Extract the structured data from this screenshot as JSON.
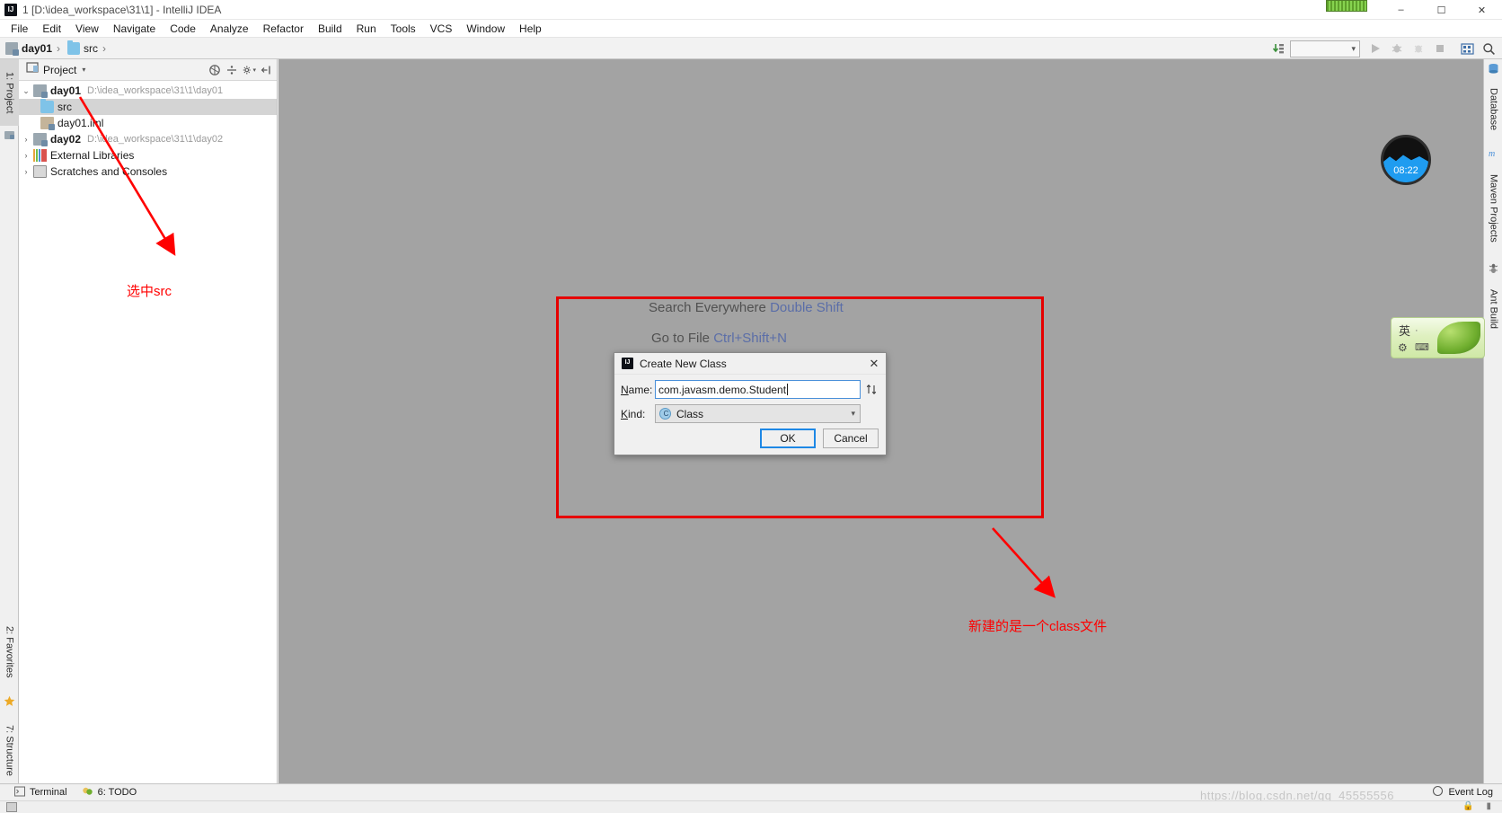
{
  "window": {
    "title": "1 [D:\\idea_workspace\\31\\1] - IntelliJ IDEA",
    "logo_icon": "intellij-idea-logo-icon",
    "minimize_icon": "minimize-icon",
    "maximize_icon": "maximize-icon",
    "close_icon": "close-icon"
  },
  "menubar": {
    "items": [
      {
        "label": "File"
      },
      {
        "label": "Edit"
      },
      {
        "label": "View"
      },
      {
        "label": "Navigate"
      },
      {
        "label": "Code"
      },
      {
        "label": "Analyze"
      },
      {
        "label": "Refactor"
      },
      {
        "label": "Build"
      },
      {
        "label": "Run"
      },
      {
        "label": "Tools"
      },
      {
        "label": "VCS"
      },
      {
        "label": "Window"
      },
      {
        "label": "Help"
      }
    ]
  },
  "navbar": {
    "crumbs": [
      {
        "label": "day01",
        "icon": "module-icon"
      },
      {
        "label": "src",
        "icon": "folder-icon"
      }
    ],
    "separator": "›",
    "right_icons": [
      "update-project-icon",
      "run-configuration-selector",
      "run-icon",
      "debug-icon",
      "coverage-icon",
      "stop-icon",
      "settings-icon",
      "search-icon"
    ],
    "run_config_value": ""
  },
  "left_strip": {
    "items": [
      {
        "label": "1: Project",
        "icon": "project-tool-icon",
        "selected": true
      },
      {
        "label": "2: Favorites",
        "icon": "star-icon",
        "selected": false
      },
      {
        "label": "7: Structure",
        "icon": "structure-icon",
        "selected": false
      }
    ]
  },
  "right_strip": {
    "items": [
      {
        "label": "Database",
        "icon": "database-icon"
      },
      {
        "label": "Maven Projects",
        "icon": "maven-icon"
      },
      {
        "label": "Ant Build",
        "icon": "ant-icon"
      }
    ]
  },
  "project_panel": {
    "header_label": "Project",
    "header_icon": "project-view-icon",
    "caret_icon": "chevron-down-icon",
    "toolbar_icons": [
      "collapse-all-icon",
      "expand-all-icon",
      "settings-gear-icon",
      "hide-panel-icon"
    ],
    "tree": [
      {
        "twist": "⌄",
        "icon": "module-icon",
        "name": "day01",
        "bold": true,
        "path": "D:\\idea_workspace\\31\\1\\day01",
        "indent": 0,
        "selected": false
      },
      {
        "twist": "",
        "icon": "folder-icon",
        "name": "src",
        "bold": false,
        "path": "",
        "indent": 1,
        "selected": true
      },
      {
        "twist": "",
        "icon": "xml-file-icon",
        "name": "day01.iml",
        "bold": false,
        "path": "",
        "indent": 1,
        "selected": false
      },
      {
        "twist": "›",
        "icon": "module-icon",
        "name": "day02",
        "bold": true,
        "path": "D:\\idea_workspace\\31\\1\\day02",
        "indent": 0,
        "selected": false
      },
      {
        "twist": "›",
        "icon": "libraries-icon",
        "name": "External Libraries",
        "bold": false,
        "path": "",
        "indent": 0,
        "selected": false
      },
      {
        "twist": "›",
        "icon": "scratches-icon",
        "name": "Scratches and Consoles",
        "bold": false,
        "path": "",
        "indent": 0,
        "selected": false
      }
    ]
  },
  "editor_hints": [
    {
      "text": "Search Everywhere",
      "key": "Double Shift"
    },
    {
      "text": "Go to File",
      "key": "Ctrl+Shift+N"
    }
  ],
  "dialog": {
    "title": "Create New Class",
    "title_icon": "intellij-idea-logo-icon",
    "close_icon": "close-icon",
    "name_label": "Name:",
    "name_value": "com.javasm.demo.Student",
    "sort_icon": "sort-toggle-icon",
    "kind_label": "Kind:",
    "kind_value": "Class",
    "kind_icon": "class-icon",
    "kind_arrow_icon": "chevron-down-icon",
    "ok_label": "OK",
    "cancel_label": "Cancel"
  },
  "annotations": {
    "color": "#ff0000",
    "note_src": "选中src",
    "note_class": "新建的是一个class文件"
  },
  "widgets": {
    "clock_time": "08:22",
    "ime_mode": "英",
    "ime_dot": "·",
    "ime_gear_icon": "gear-icon",
    "ime_keyboard_icon": "keyboard-icon"
  },
  "statusbar": {
    "terminal_label": "Terminal",
    "terminal_icon": "terminal-icon",
    "todo_label": "6: TODO",
    "todo_icon": "todo-icon",
    "event_log_label": "Event Log",
    "event_log_icon": "event-log-icon"
  },
  "watermark": "https://blog.csdn.net/qq_45555556"
}
